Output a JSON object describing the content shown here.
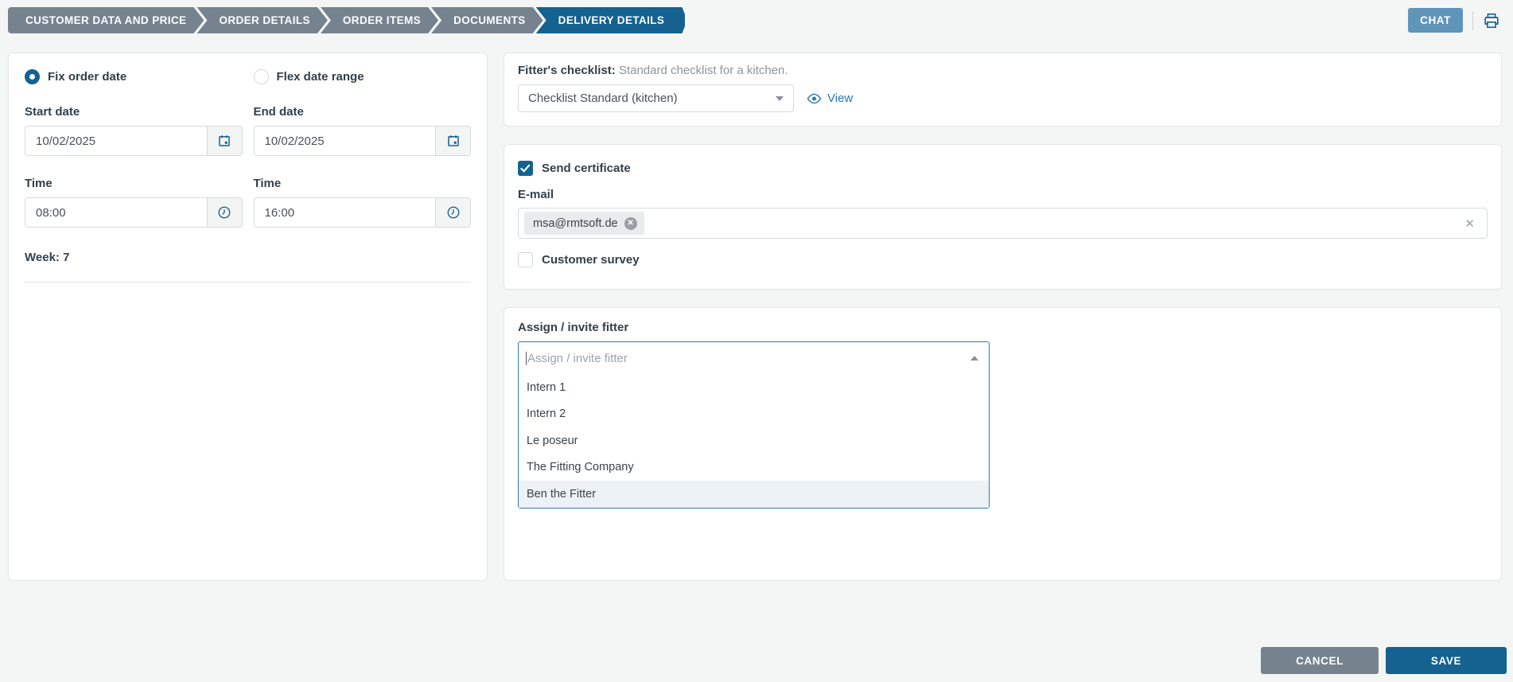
{
  "header": {
    "steps": [
      {
        "label": "CUSTOMER DATA AND PRICE",
        "active": false
      },
      {
        "label": "ORDER DETAILS",
        "active": false
      },
      {
        "label": "ORDER ITEMS",
        "active": false
      },
      {
        "label": "DOCUMENTS",
        "active": false
      },
      {
        "label": "DELIVERY DETAILS",
        "active": true
      }
    ],
    "chat_label": "CHAT"
  },
  "schedule": {
    "fix_order_date_label": "Fix order date",
    "flex_date_range_label": "Flex date range",
    "fix_order_date_selected": true,
    "start_date_label": "Start date",
    "end_date_label": "End date",
    "start_date_value": "10/02/2025",
    "end_date_value": "10/02/2025",
    "start_time_label": "Time",
    "end_time_label": "Time",
    "start_time_value": "08:00",
    "end_time_value": "16:00",
    "week_label": "Week: 7"
  },
  "checklist": {
    "label": "Fitter's checklist:",
    "description": "Standard checklist for a kitchen.",
    "selected_option": "Checklist Standard (kitchen)",
    "view_label": "View"
  },
  "certificate": {
    "send_certificate_label": "Send certificate",
    "send_certificate_checked": true,
    "email_label": "E-mail",
    "email_chip": "msa@rmtsoft.de",
    "customer_survey_label": "Customer survey",
    "customer_survey_checked": false
  },
  "fitter": {
    "label": "Assign / invite fitter",
    "placeholder": "Assign / invite fitter",
    "options": [
      {
        "label": "Intern 1",
        "highlighted": false
      },
      {
        "label": "Intern 2",
        "highlighted": false
      },
      {
        "label": "Le poseur",
        "highlighted": false
      },
      {
        "label": "The Fitting Company",
        "highlighted": false
      },
      {
        "label": "Ben the Fitter",
        "highlighted": true
      }
    ]
  },
  "footer": {
    "cancel_label": "CANCEL",
    "save_label": "SAVE"
  },
  "colors": {
    "accent_dark_blue": "#15618f",
    "steel_blue": "#6095ba",
    "breadcrumb_gray": "#76838f",
    "link_blue": "#2579ad",
    "option_highlight": "#edf2f7",
    "page_background": "#f4f6f6"
  }
}
